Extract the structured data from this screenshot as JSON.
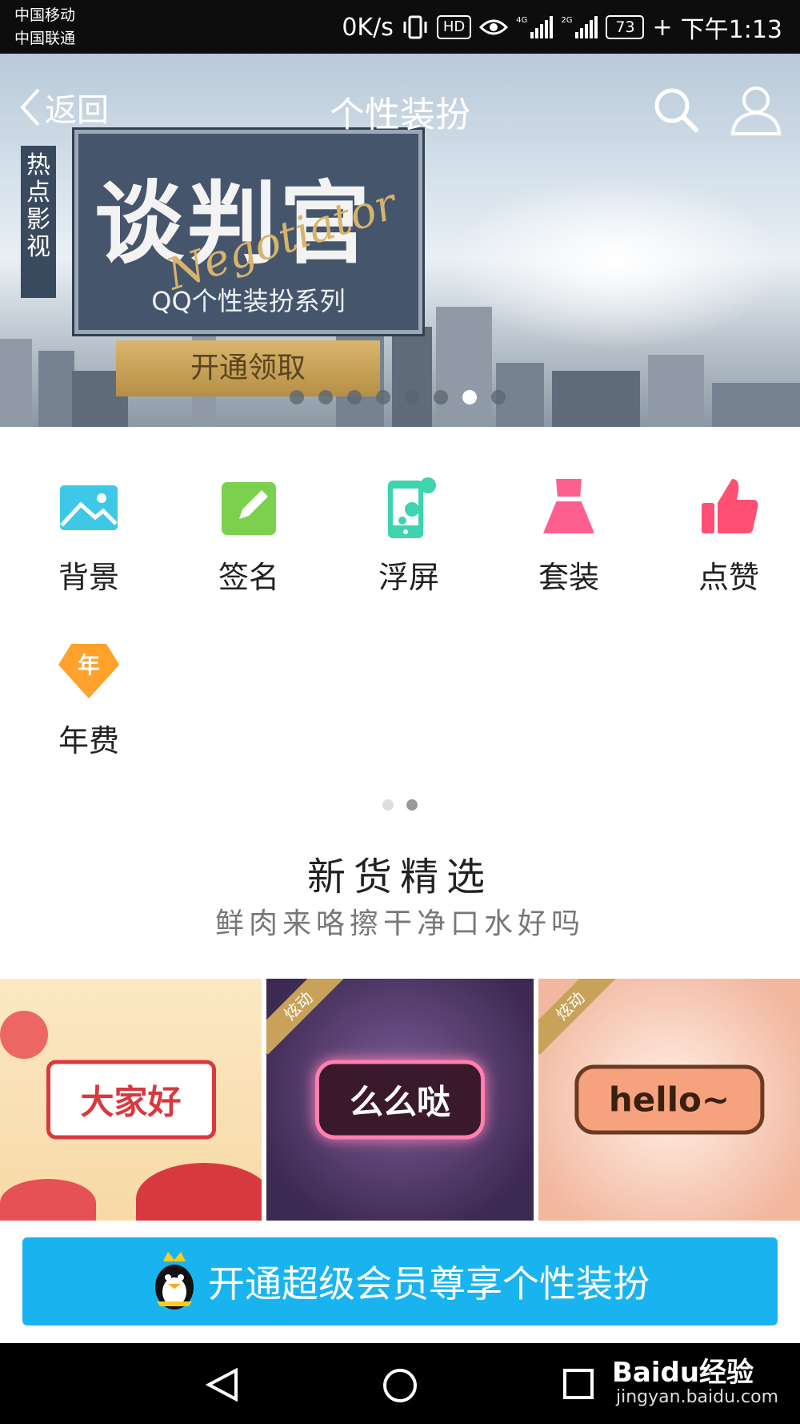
{
  "status_bar": {
    "carrier1": "中国移动",
    "carrier2": "中国联通",
    "speed": "0K/s",
    "hd": "HD",
    "net1": "4G",
    "net2": "2G",
    "battery": "73",
    "time": "下午1:13"
  },
  "nav": {
    "back_label": "返回",
    "title": "个性装扮",
    "search_icon": "search-icon",
    "user_icon": "user-icon"
  },
  "banner": {
    "tag_chars": [
      "热",
      "点",
      "影",
      "视"
    ],
    "title": "谈判官",
    "script": "Negotiator",
    "subtitle": "QQ个性装扮系列",
    "cta": "开通领取",
    "dots_total": 8,
    "dots_active": 7
  },
  "categories": [
    {
      "label": "背景",
      "icon": "image-icon",
      "color": "#3ec8e8"
    },
    {
      "label": "签名",
      "icon": "edit-icon",
      "color": "#7bd14e"
    },
    {
      "label": "浮屏",
      "icon": "phone-icon",
      "color": "#3fd3b0"
    },
    {
      "label": "套装",
      "icon": "dress-icon",
      "color": "#ff5f8f"
    },
    {
      "label": "点赞",
      "icon": "thumbs-up-icon",
      "color": "#ff4f73"
    },
    {
      "label": "年费",
      "icon": "annual-badge-icon",
      "color": "#ffa12a",
      "badge": "年"
    }
  ],
  "pager": {
    "total": 2,
    "active": 2
  },
  "section": {
    "title": "新货精选",
    "subtitle": "鲜肉来咯擦干净口水好吗"
  },
  "cards": [
    {
      "label": "大家好",
      "ribbon": ""
    },
    {
      "label": "么么哒",
      "ribbon": "炫动"
    },
    {
      "label": "hello~",
      "ribbon": "炫动"
    }
  ],
  "join_button": "开通超级会员尊享个性装扮",
  "watermark": {
    "logo": "Baidu经验",
    "url": "jingyan.baidu.com"
  }
}
